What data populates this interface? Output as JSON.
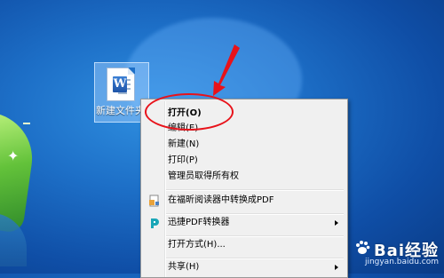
{
  "desktop": {
    "icon_label": "新建文件夹",
    "icon_badge": "W"
  },
  "context_menu": {
    "items": [
      {
        "label": "打开(O)",
        "bold": true
      },
      {
        "label": "编辑(E)"
      },
      {
        "label": "新建(N)"
      },
      {
        "label": "打印(P)"
      },
      {
        "label": "管理员取得所有权"
      },
      {
        "label": "在福昕阅读器中转换成PDF",
        "icon": "foxit-pdf-icon"
      },
      {
        "label": "迅捷PDF转换器",
        "icon": "xunjie-pdf-icon",
        "submenu": true
      },
      {
        "label": "打开方式(H)..."
      },
      {
        "label": "共享(H)",
        "submenu": true
      }
    ]
  },
  "watermark": {
    "brand": "Bai经验",
    "url": "jingyan.baidu.com"
  },
  "colors": {
    "annotation_red": "#e8121a",
    "menu_bg": "#f0f0f0",
    "desktop_blue": "#1d6fc7"
  }
}
